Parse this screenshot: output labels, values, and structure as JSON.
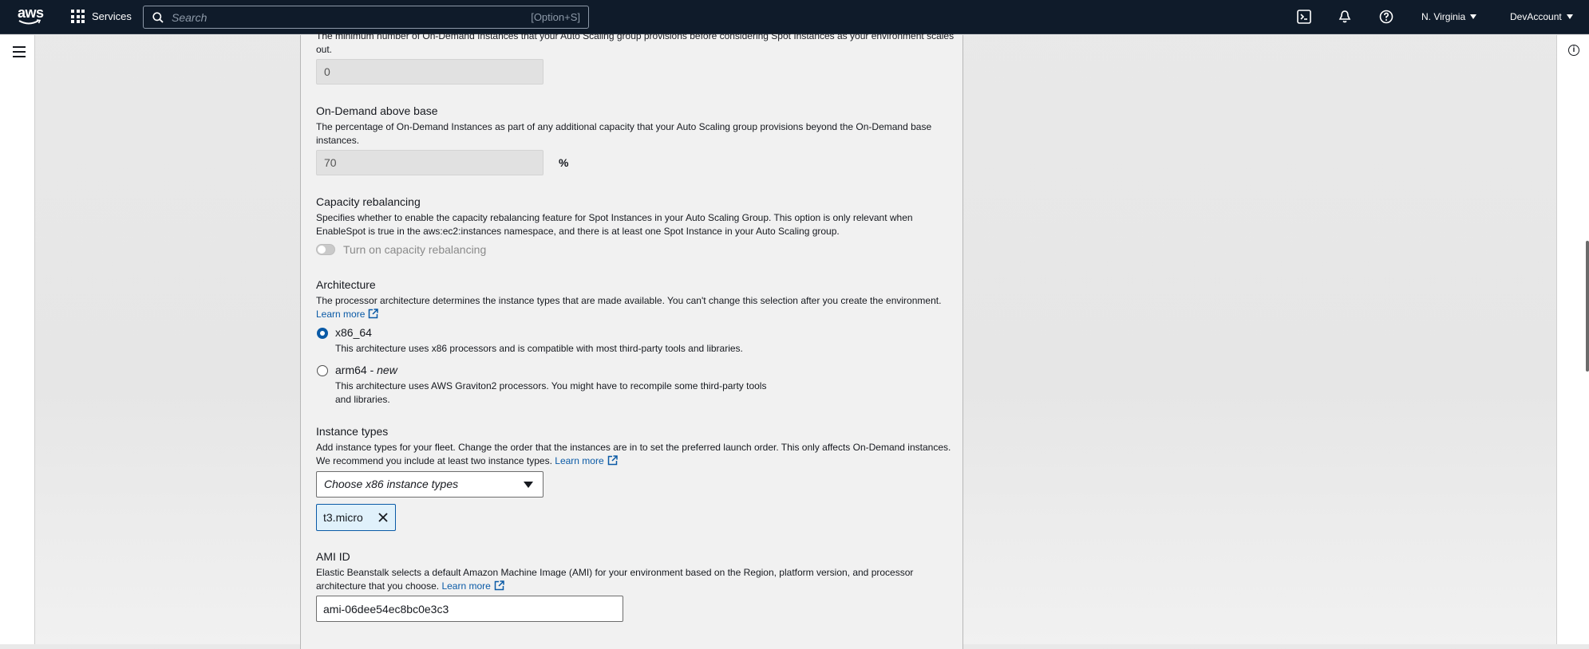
{
  "nav": {
    "logo": "aws",
    "services": "Services",
    "search_placeholder": "Search",
    "search_shortcut": "[Option+S]",
    "region": "N. Virginia",
    "account": "DevAccount",
    "icons": [
      "cloudshell-icon",
      "bell-icon",
      "help-icon"
    ]
  },
  "form": {
    "on_demand_base": {
      "desc": "The minimum number of On-Demand Instances that your Auto Scaling group provisions before considering Spot Instances as your environment scales out.",
      "value": "0"
    },
    "on_demand_above": {
      "label": "On-Demand above base",
      "desc": "The percentage of On-Demand Instances as part of any additional capacity that your Auto Scaling group provisions beyond the On-Demand base instances.",
      "value": "70",
      "unit": "%"
    },
    "capacity": {
      "label": "Capacity rebalancing",
      "desc": "Specifies whether to enable the capacity rebalancing feature for Spot Instances in your Auto Scaling Group. This option is only relevant when EnableSpot is true in the aws:ec2:instances namespace, and there is at least one Spot Instance in your Auto Scaling group.",
      "toggle_label": "Turn on capacity rebalancing"
    },
    "architecture": {
      "label": "Architecture",
      "desc": "The processor architecture determines the instance types that are made available. You can't change this selection after you create the environment.",
      "learn_more": "Learn more",
      "options": [
        {
          "label": "x86_64",
          "desc": "This architecture uses x86 processors and is compatible with most third-party tools and libraries.",
          "selected": true
        },
        {
          "label": "arm64 - ",
          "label_em": "new",
          "desc": "This architecture uses AWS Graviton2 processors. You might have to recompile some third-party tools and libraries.",
          "selected": false
        }
      ]
    },
    "instance_types": {
      "label": "Instance types",
      "desc": "Add instance types for your fleet. Change the order that the instances are in to set the preferred launch order. This only affects On-Demand instances. We recommend you include at least two instance types.",
      "learn_more": "Learn more",
      "select_placeholder": "Choose x86 instance types",
      "token": "t3.micro"
    },
    "ami": {
      "label": "AMI ID",
      "desc": "Elastic Beanstalk selects a default Amazon Machine Image (AMI) for your environment based on the Region, platform version, and processor architecture that you choose.",
      "learn_more": "Learn more",
      "value": "ami-06dee54ec8bc0e3c3"
    }
  }
}
